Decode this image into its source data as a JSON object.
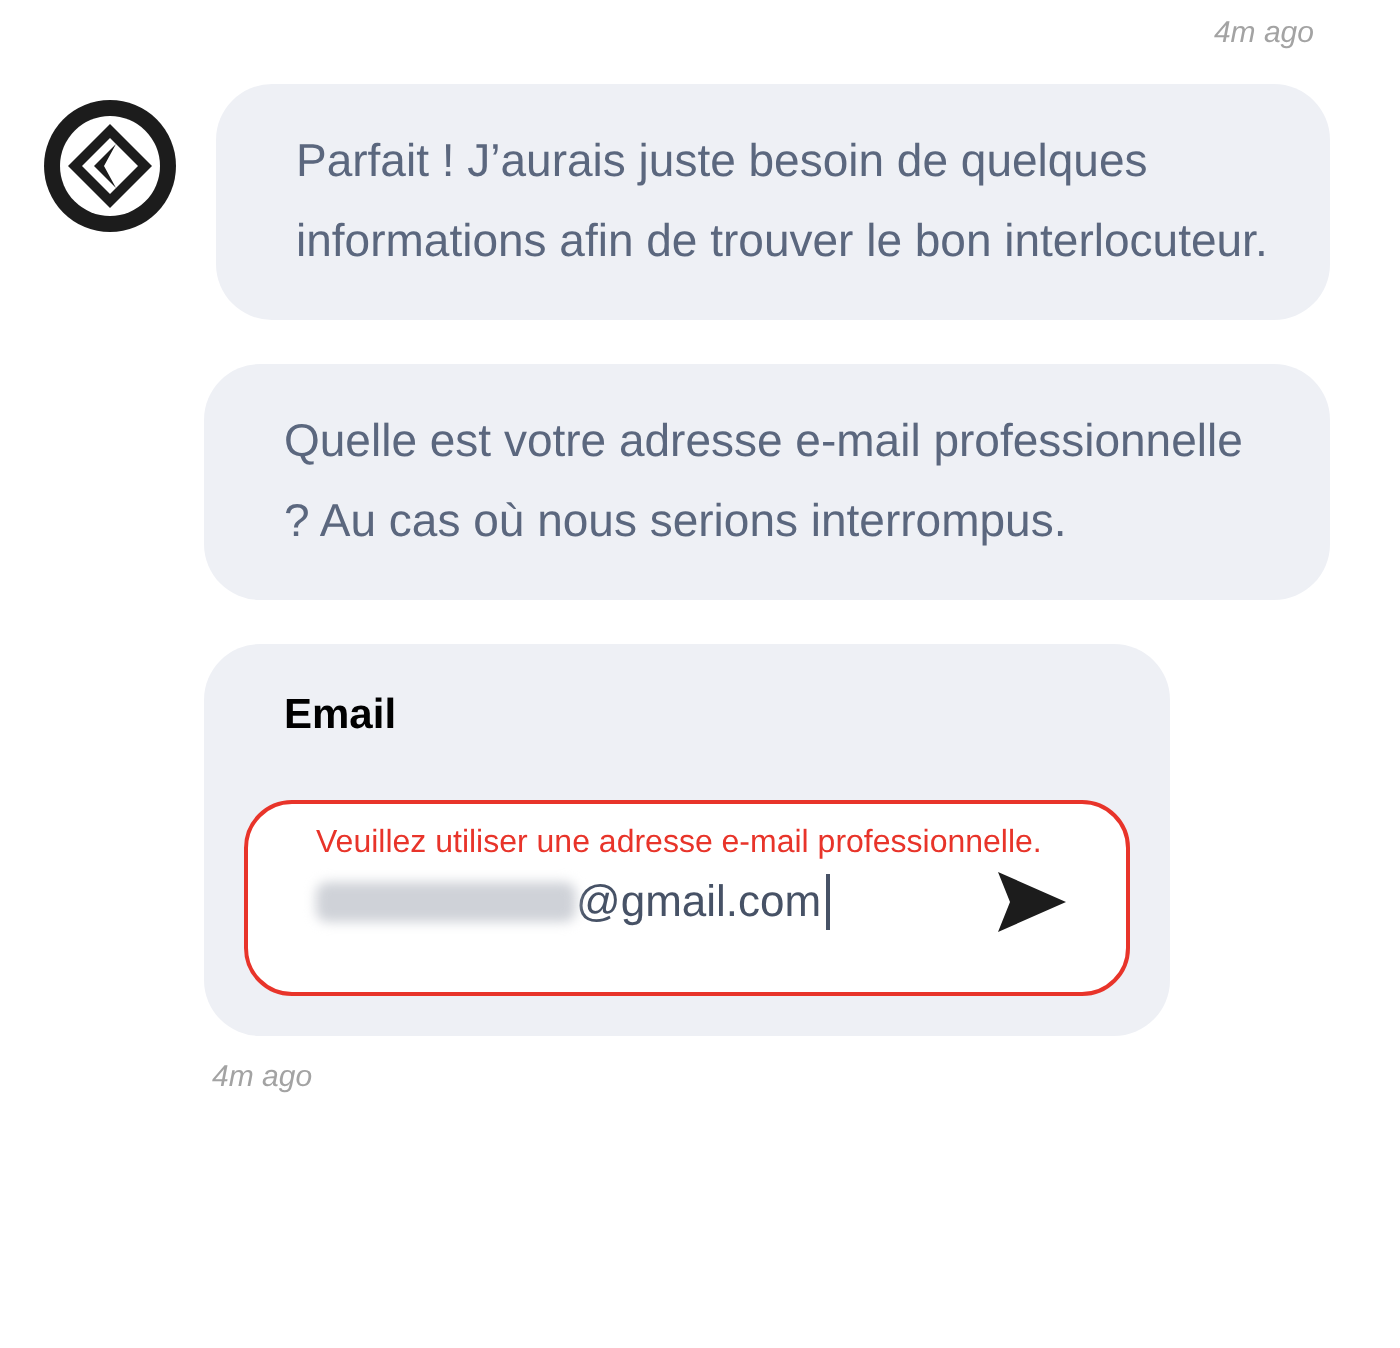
{
  "top_timestamp": "4m ago",
  "messages": [
    {
      "text": "Parfait ! J’aurais juste besoin de quelques informations afin de trouver le bon interlocuteur.",
      "avatar": true
    },
    {
      "text": "Quelle est votre adresse e-mail professionnelle ? Au cas où nous serions interrompus.",
      "avatar": false
    }
  ],
  "email_form": {
    "label": "Email",
    "error": "Veuillez utiliser une adresse e-mail professionnelle.",
    "value": "@gmail.com",
    "redacted": true,
    "invalid": true
  },
  "bottom_timestamp": "4m ago"
}
